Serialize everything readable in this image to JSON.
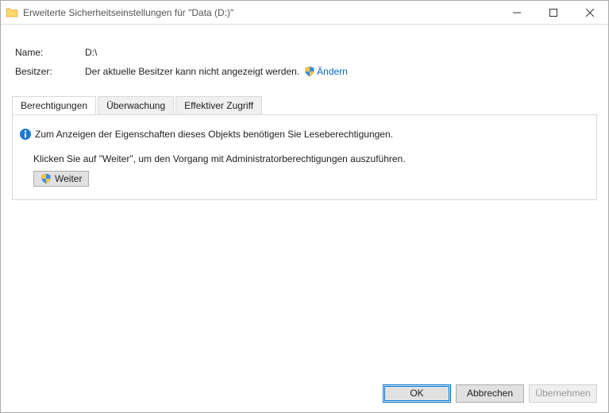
{
  "window": {
    "title": "Erweiterte Sicherheitseinstellungen für \"Data (D:)\""
  },
  "info": {
    "name_label": "Name:",
    "name_value": "D:\\",
    "owner_label": "Besitzer:",
    "owner_value": "Der aktuelle Besitzer kann nicht angezeigt werden.",
    "change_link": "Ändern"
  },
  "tabs": {
    "permissions": "Berechtigungen",
    "auditing": "Überwachung",
    "effective": "Effektiver Zugriff"
  },
  "messages": {
    "need_read": "Zum Anzeigen der Eigenschaften dieses Objekts benötigen Sie Leseberechtigungen.",
    "click_continue": "Klicken Sie auf \"Weiter\", um den Vorgang mit Administratorberechtigungen auszuführen.",
    "continue_btn": "Weiter"
  },
  "footer": {
    "ok": "OK",
    "cancel": "Abbrechen",
    "apply": "Übernehmen"
  }
}
